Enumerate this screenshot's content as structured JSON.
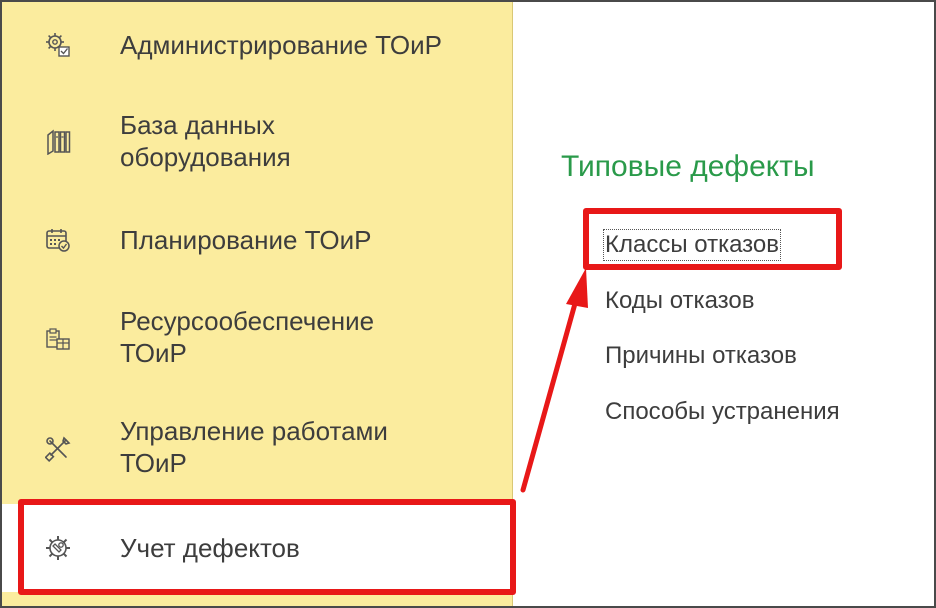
{
  "sidebar": {
    "items": [
      {
        "label": "Администрирование ТОиР",
        "icon": "gear-settings-icon"
      },
      {
        "label": "База данных\nоборудования",
        "icon": "books-icon"
      },
      {
        "label": "Планирование ТОиР",
        "icon": "calendar-icon"
      },
      {
        "label": "Ресурсообеспечение\nТОиР",
        "icon": "resources-icon"
      },
      {
        "label": "Управление работами\nТОиР",
        "icon": "tools-icon"
      },
      {
        "label": "Учет дефектов",
        "icon": "defect-gear-icon"
      }
    ],
    "active_index": 5
  },
  "panel": {
    "title": "Типовые дефекты",
    "links": [
      {
        "label": "Классы отказов"
      },
      {
        "label": "Коды отказов"
      },
      {
        "label": "Причины отказов"
      },
      {
        "label": "Способы устранения"
      }
    ]
  },
  "colors": {
    "sidebar_bg": "#fbec9e",
    "title_green": "#2a9a4a",
    "highlight_red": "#e81818"
  }
}
